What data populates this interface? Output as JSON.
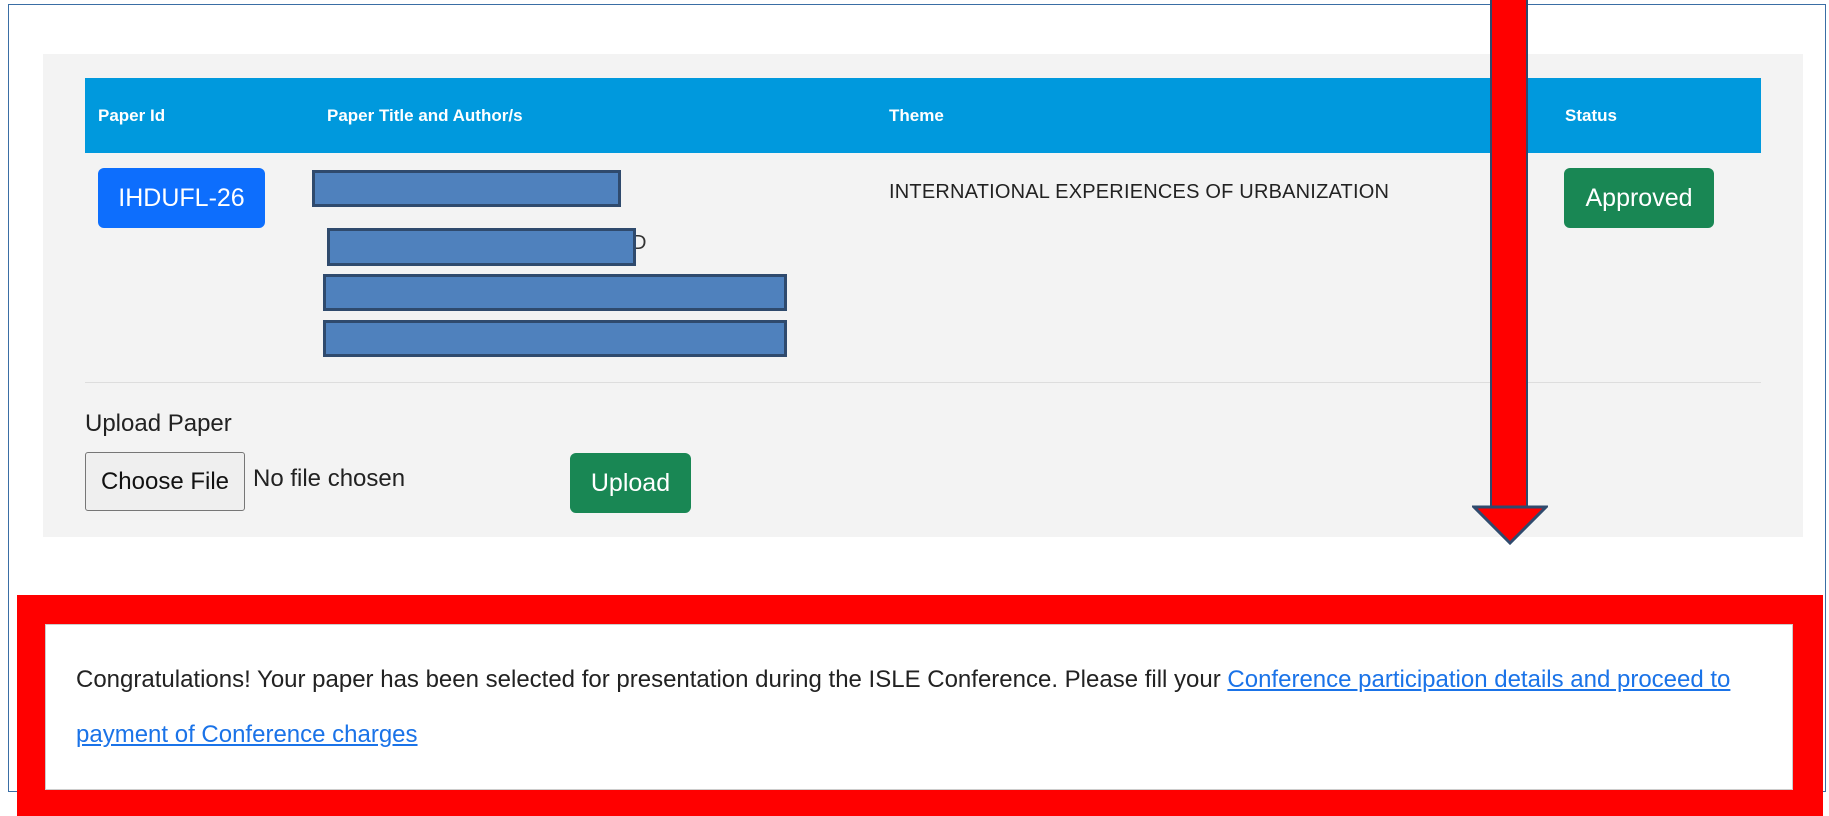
{
  "table": {
    "headers": {
      "paper_id": "Paper Id",
      "paper_title": "Paper Title and Author/s",
      "theme": "Theme",
      "status": "Status"
    },
    "rows": [
      {
        "paper_id": "IHDUFL-26",
        "theme": "INTERNATIONAL EXPERIENCES OF URBANIZATION",
        "status": "Approved",
        "partial_visible_char": "D"
      }
    ]
  },
  "upload": {
    "label": "Upload Paper",
    "choose_file_label": "Choose File",
    "file_status": "No file chosen",
    "upload_button_label": "Upload"
  },
  "notice": {
    "message": "Congratulations! Your paper has been selected for presentation during the ISLE Conference. Please fill your ",
    "link_text": "Conference participation details and proceed to payment of Conference charges"
  },
  "colors": {
    "header_bg": "#0099dd",
    "id_badge": "#0d6efd",
    "success": "#198754",
    "annotation_red": "#ff0000",
    "redaction_fill": "#4f81bd",
    "link": "#1a73e8"
  }
}
